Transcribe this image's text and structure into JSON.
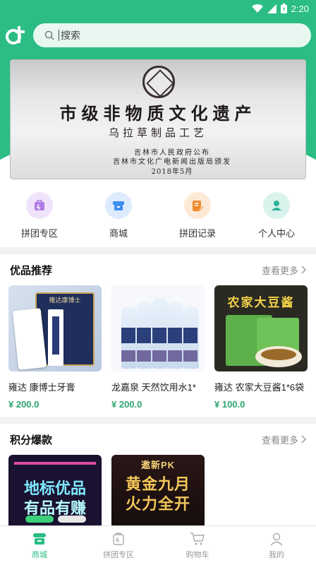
{
  "status_bar": {
    "time": "2:20"
  },
  "search": {
    "placeholder": "搜索"
  },
  "banner": {
    "title": "市级非物质文化遗产",
    "subtitle": "乌拉草制品工艺",
    "line1": "吉林市人民政府公布",
    "line2": "吉林市文化广电新闻出版局颁发",
    "line3": "2018年5月"
  },
  "quick_nav": [
    {
      "label": "拼团专区",
      "icon": "group-buy-icon",
      "color": "#b07be8",
      "bg": "#efe4fb"
    },
    {
      "label": "商城",
      "icon": "mall-icon",
      "color": "#3d8ff0",
      "bg": "#dcebfd"
    },
    {
      "label": "拼团记录",
      "icon": "record-icon",
      "color": "#f08a2e",
      "bg": "#fde9d6"
    },
    {
      "label": "个人中心",
      "icon": "person-icon",
      "color": "#2bb39a",
      "bg": "#d9f2ec"
    }
  ],
  "featured": {
    "title": "优品推荐",
    "see_more": "查看更多",
    "products": [
      {
        "name": "雍达 康博士牙膏",
        "price": "¥ 200.0",
        "image": "toothpaste",
        "img_text": "雍达康博士"
      },
      {
        "name": "龙嘉泉 天然饮用水1*",
        "price": "¥ 200.0",
        "image": "water-bottles",
        "img_text": ""
      },
      {
        "name": "雍达 农家大豆酱1*6袋",
        "price": "¥ 100.0",
        "image": "soybean-paste",
        "img_text": "农家大豆酱"
      }
    ]
  },
  "points": {
    "title": "积分爆款",
    "see_more": "查看更多",
    "cards": [
      {
        "line1": "地标优品",
        "line2": "有品有赚",
        "image": "promo-card-1"
      },
      {
        "line0": "邀新PK",
        "line1": "黄金九月",
        "line2": "火力全开",
        "image": "promo-card-2"
      }
    ]
  },
  "bottom_nav": [
    {
      "label": "商城",
      "icon": "mall-tab-icon",
      "active": true
    },
    {
      "label": "拼团专区",
      "icon": "group-tab-icon",
      "active": false
    },
    {
      "label": "购物车",
      "icon": "cart-icon",
      "active": false
    },
    {
      "label": "我的",
      "icon": "profile-icon",
      "active": false
    }
  ],
  "colors": {
    "brand": "#2bbd84",
    "price": "#2ba56e"
  }
}
